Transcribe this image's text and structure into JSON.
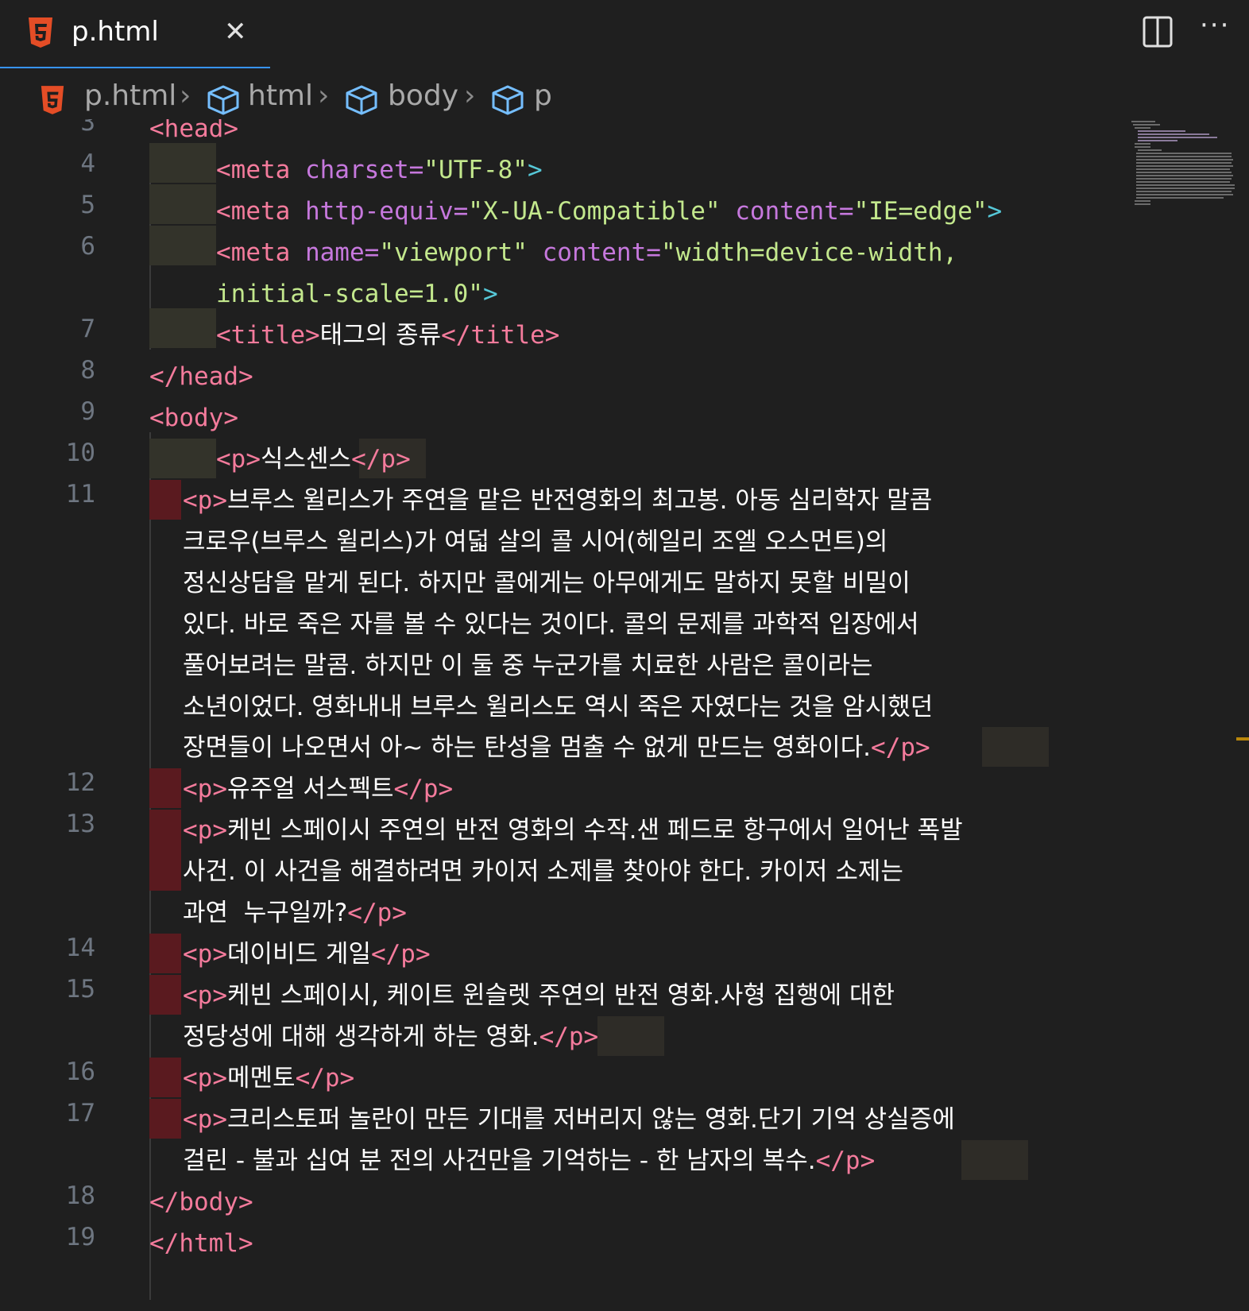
{
  "tab": {
    "title": "p.html",
    "close_glyph": "✕",
    "icon": "html5-icon"
  },
  "actions": {
    "more_glyph": "···"
  },
  "breadcrumb": {
    "file": "p.html",
    "items": [
      "html",
      "body",
      "p"
    ],
    "separator": "›"
  },
  "colors": {
    "tag": "#f47b9c",
    "attribute": "#c678dd",
    "string": "#c3e88d",
    "bracket": "#56c8d8",
    "text": "#ffffff",
    "line_number": "#6e7681",
    "background": "#1f1f1f"
  },
  "line_numbers": [
    "3",
    "4",
    "5",
    "6",
    "7",
    "8",
    "9",
    "10",
    "11",
    "12",
    "13",
    "14",
    "15",
    "16",
    "17",
    "18",
    "19"
  ],
  "code": {
    "l3": "<head>",
    "l4_tag": "<meta ",
    "l4_attr": "charset=",
    "l4_val": "\"UTF-8\"",
    "l4_end": ">",
    "l5_tag": "<meta ",
    "l5_attr1": "http-equiv=",
    "l5_val1": "\"X-UA-Compatible\"",
    "l5_attr2": " content=",
    "l5_val2": "\"IE=edge\"",
    "l5_end": ">",
    "l6_tag": "<meta ",
    "l6_attr1": "name=",
    "l6_val1": "\"viewport\"",
    "l6_attr2": " content=",
    "l6_val2a": "\"width=device-width,",
    "l6_val2b": "initial-scale=1.0\"",
    "l6_end": ">",
    "l7_open": "<title>",
    "l7_text": "태그의 종류",
    "l7_close": "</title>",
    "l8": "</head>",
    "l9": "<body>",
    "p_open": "<p>",
    "p_close": "</p>",
    "l10_text": "식스센스",
    "l11_text": [
      "브루스 윌리스가 주연을 맡은 반전영화의 최고봉. 아동 심리학자 말콤",
      "크로우(브루스 윌리스)가 여덟 살의 콜 시어(헤일리 조엘 오스먼트)의",
      "정신상담을 맡게 된다. 하지만 콜에게는 아무에게도 말하지 못할 비밀이",
      "있다. 바로 죽은 자를 볼 수 있다는 것이다. 콜의 문제를 과학적 입장에서",
      "풀어보려는 말콤. 하지만 이 둘 중 누군가를 치료한 사람은 콜이라는",
      "소년이었다. 영화내내 브루스 윌리스도 역시 죽은 자였다는 것을 암시했던",
      "장면들이 나오면서 아~ 하는 탄성을 멈출 수 없게 만드는 영화이다."
    ],
    "l12_text": "유주얼 서스펙트",
    "l13_text": [
      "케빈 스페이시 주연의 반전 영화의 수작.샌 페드로 항구에서 일어난 폭발",
      "사건. 이 사건을 해결하려면 카이저 소제를 찾아야 한다. 카이저 소제는",
      "과연  누구일까?"
    ],
    "l14_text": "데이비드 게일",
    "l15_text": [
      "케빈 스페이시, 케이트 윈슬렛 주연의 반전 영화.사형 집행에 대한",
      "정당성에 대해 생각하게 하는 영화."
    ],
    "l16_text": "메멘토",
    "l17_text": [
      "크리스토퍼 놀란이 만든 기대를 저버리지 않는 영화.단기 기억 상실증에",
      "걸린 - 불과 십여 분 전의 사건만을 기억하는 - 한 남자의 복수."
    ],
    "l18": "</body>",
    "l19": "</html>"
  }
}
